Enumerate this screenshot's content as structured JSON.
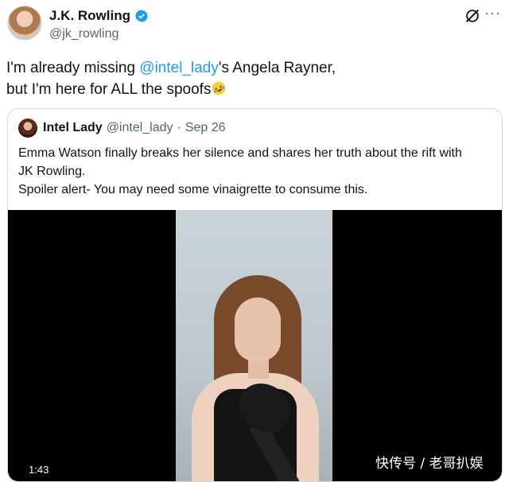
{
  "author": {
    "name": "J.K. Rowling",
    "handle": "@jk_rowling",
    "verified": true
  },
  "icons": {
    "verified": "verified-badge-icon",
    "grok": "grok-icon",
    "more": "more-icon",
    "emoji": "rolling-on-floor-laughing-emoji"
  },
  "tweet": {
    "line1_prefix": "I'm already missing ",
    "mention": "@intel_lady",
    "line1_suffix": "'s Angela Rayner,",
    "line2": "but I'm here for ALL the spoofs"
  },
  "quoted": {
    "name": "Intel Lady",
    "handle": "@intel_lady",
    "separator": "·",
    "date": "Sep 26",
    "lines": [
      "Emma Watson finally breaks her silence and shares her truth about the rift with",
      "JK Rowling.",
      "Spoiler alert- You may need some vinaigrette to consume this."
    ],
    "video": {
      "duration": "1:43"
    }
  },
  "watermark": "快传号 / 老哥扒娱",
  "colors": {
    "accent": "#1d9bf0",
    "muted": "#536471",
    "border": "#cfd9de"
  }
}
